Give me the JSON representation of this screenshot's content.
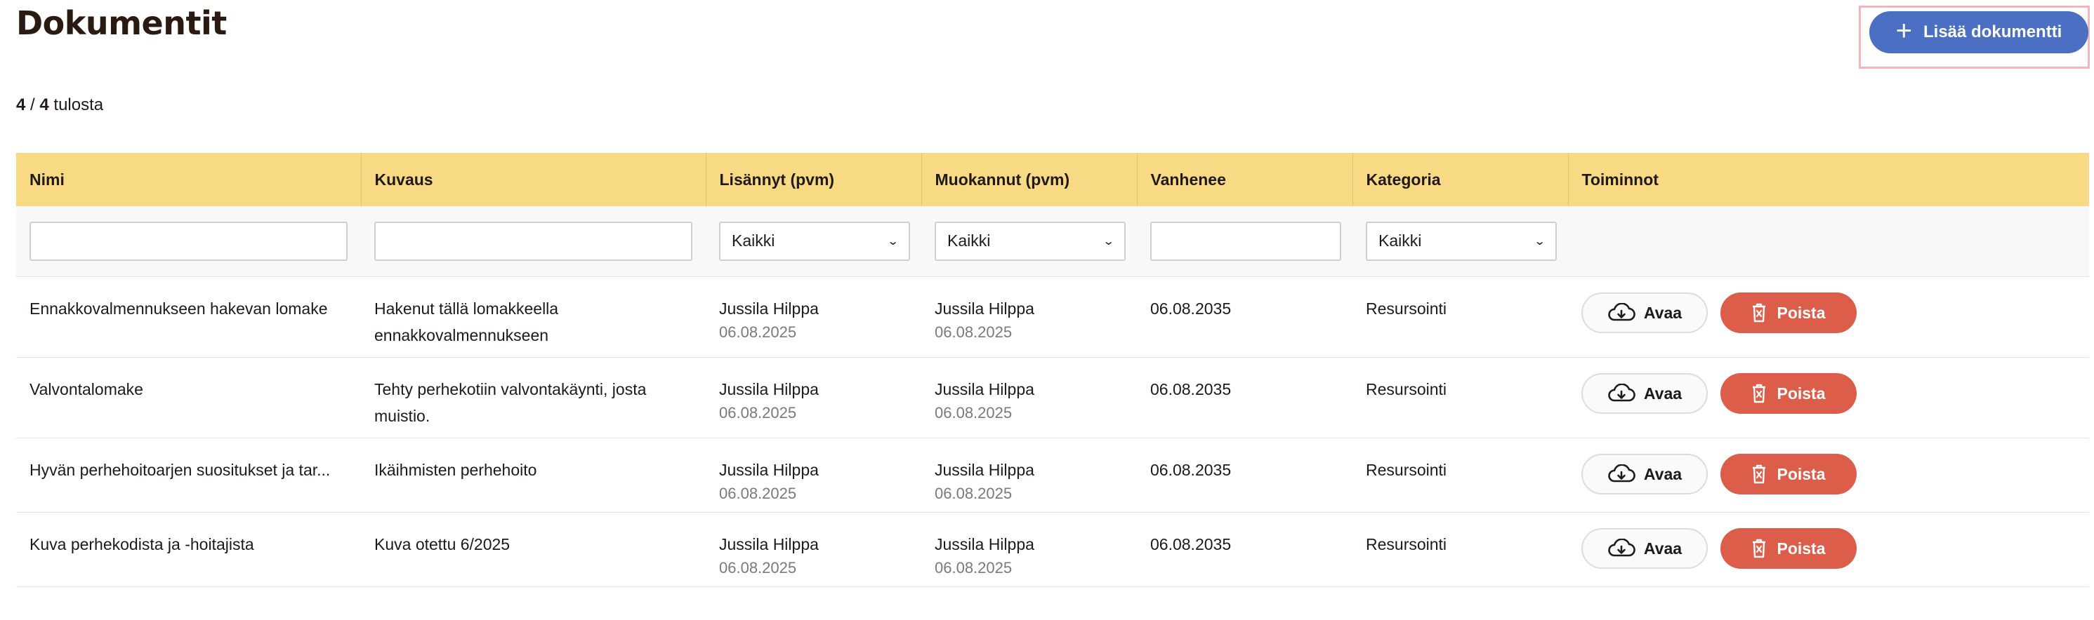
{
  "header": {
    "title": "Dokumentit",
    "add_button_label": "Lisää dokumentti"
  },
  "results": {
    "shown": "4",
    "separator": " / ",
    "total": "4",
    "suffix": " tulosta"
  },
  "table": {
    "columns": [
      "Nimi",
      "Kuvaus",
      "Lisännyt (pvm)",
      "Muokannut (pvm)",
      "Vanhenee",
      "Kategoria",
      "Toiminnot"
    ],
    "filters": {
      "added_select": "Kaikki",
      "modified_select": "Kaikki",
      "category_select": "Kaikki"
    },
    "open_label": "Avaa",
    "delete_label": "Poista",
    "rows": [
      {
        "name": "Ennakkovalmennukseen hakevan lomake",
        "description": "Hakenut tällä lomakkeella ennakkovalmennukseen",
        "added_by": "Jussila Hilppa",
        "added_date": "06.08.2025",
        "modified_by": "Jussila Hilppa",
        "modified_date": "06.08.2025",
        "expires": "06.08.2035",
        "category": "Resursointi"
      },
      {
        "name": "Valvontalomake",
        "description": "Tehty perhekotiin valvontakäynti, josta muistio.",
        "added_by": "Jussila Hilppa",
        "added_date": "06.08.2025",
        "modified_by": "Jussila Hilppa",
        "modified_date": "06.08.2025",
        "expires": "06.08.2035",
        "category": "Resursointi"
      },
      {
        "name": "Hyvän perhehoitoarjen suositukset ja tar...",
        "description": "Ikäihmisten perhehoito",
        "added_by": "Jussila Hilppa",
        "added_date": "06.08.2025",
        "modified_by": "Jussila Hilppa",
        "modified_date": "06.08.2025",
        "expires": "06.08.2035",
        "category": "Resursointi"
      },
      {
        "name": "Kuva perhekodista ja -hoitajista",
        "description": "Kuva otettu 6/2025",
        "added_by": "Jussila Hilppa",
        "added_date": "06.08.2025",
        "modified_by": "Jussila Hilppa",
        "modified_date": "06.08.2025",
        "expires": "06.08.2035",
        "category": "Resursointi"
      }
    ]
  },
  "icons": {
    "add": "plus-icon",
    "open": "cloud-download-icon",
    "delete": "trash-icon",
    "select": "chevron-down-icon"
  },
  "colors": {
    "header_bg": "#f8da84",
    "primary": "#4a6fc3",
    "danger": "#dc5d4a"
  }
}
